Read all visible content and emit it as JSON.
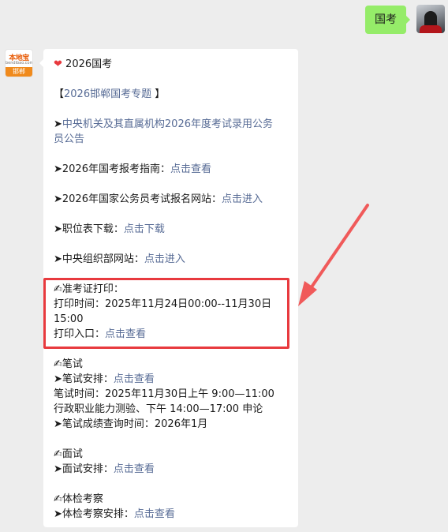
{
  "self_message": {
    "text": "国考"
  },
  "bot": {
    "avatar_logo": "本地宝",
    "avatar_sub": "bendibao.com",
    "avatar_city": "邯郸"
  },
  "reply": {
    "title": "2026国考",
    "topic_open": "【",
    "topic_link": "2026邯郸国考专题",
    "topic_close": " 】",
    "item1_prefix": "➤",
    "item1_link_line1": "中央机关及其直属机构2026年度考试录用公务",
    "item1_link_line2": "员公告",
    "item2_label": "➤2026年国考报考指南：",
    "item2_link": "点击查看",
    "item3_label": "➤2026年国家公务员考试报名网站：",
    "item3_link": "点击进入",
    "item4_label": "➤职位表下载：",
    "item4_link": "点击下载",
    "item5_label": "➤中央组织部网站：",
    "item5_link": "点击进入",
    "admit_title": "✍准考证打印：",
    "admit_time_line1": "打印时间：2025年11月24日00:00--11月30日",
    "admit_time_line2": "15:00",
    "admit_entry_label": "打印入口：",
    "admit_entry_link": "点击查看",
    "written_title": "✍笔试",
    "written_arrange_label": "➤笔试安排：",
    "written_arrange_link": "点击查看",
    "written_time_line1": "笔试时间：2025年11月30日上午 9:00—11:00",
    "written_time_line2": "行政职业能力测验、下午 14:00—17:00 申论",
    "written_score": "➤笔试成绩查询时间：2026年1月",
    "interview_title": "✍面试",
    "interview_arrange_label": "➤面试安排：",
    "interview_arrange_link": "点击查看",
    "physical_title": "✍体检考察",
    "physical_arrange_label": "➤体检考察安排：",
    "physical_arrange_link": "点击查看"
  },
  "colors": {
    "chat_bg": "#ededed",
    "self_bubble": "#95ec69",
    "link": "#576b95",
    "highlight": "#e83a3e"
  }
}
